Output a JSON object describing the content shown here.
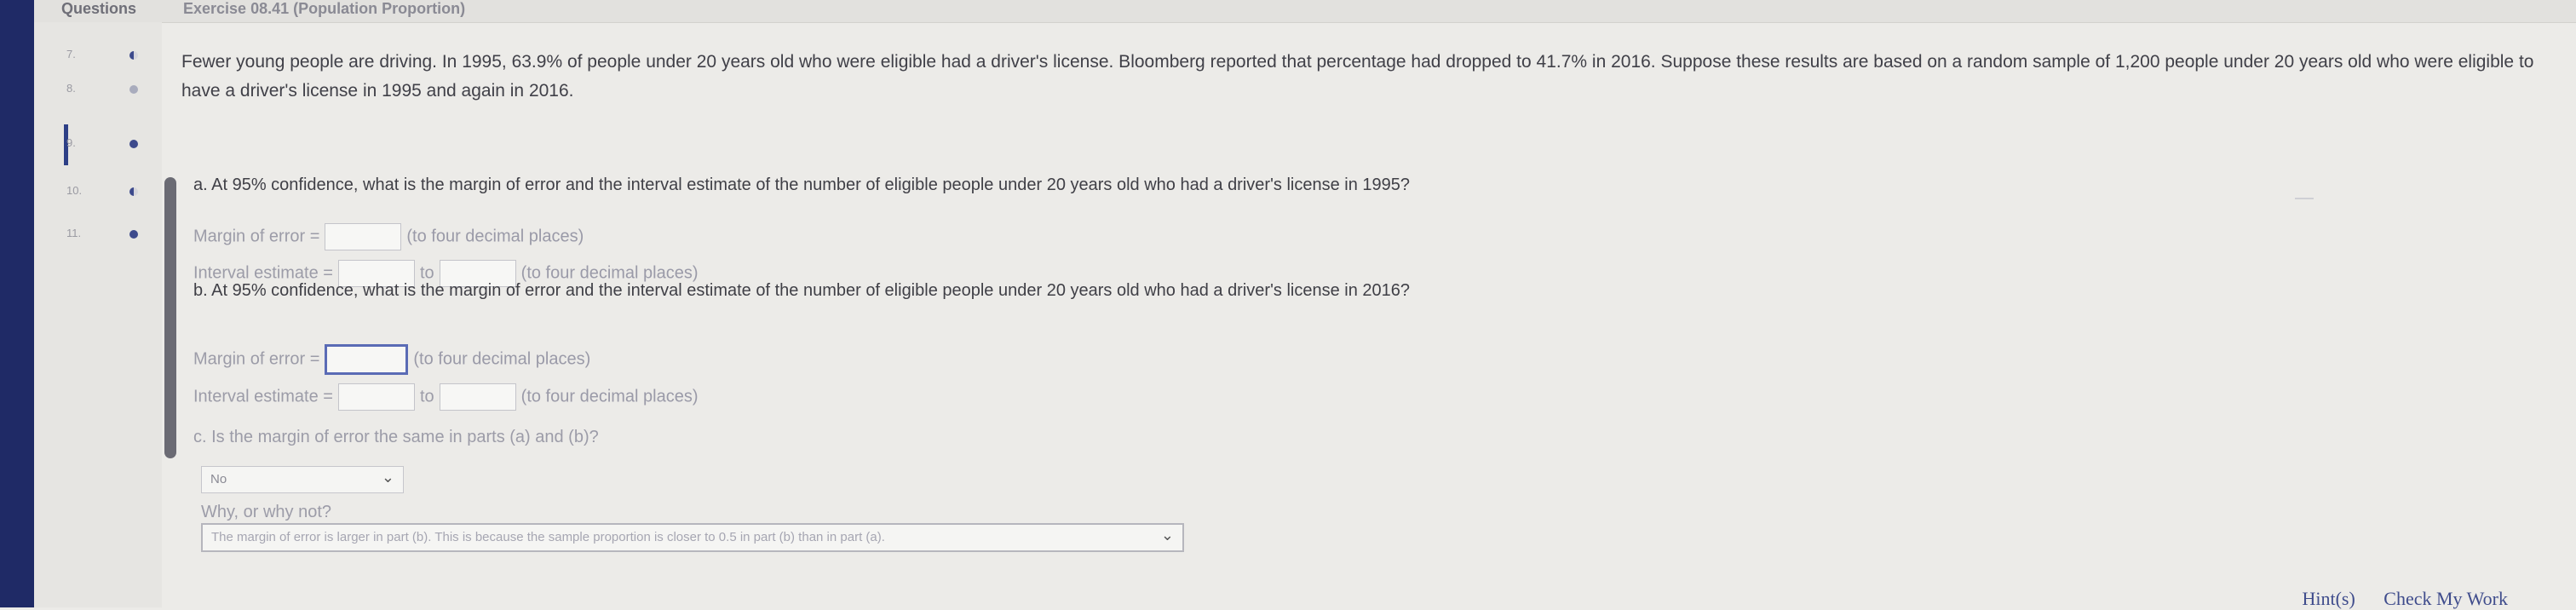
{
  "topbar": {
    "questions_tab": "Questions",
    "exercise_title": "Exercise 08.41 (Population Proportion)"
  },
  "sidebar": {
    "rows": [
      {
        "num": "7.",
        "status": "half"
      },
      {
        "num": "8.",
        "status": "dim"
      },
      {
        "num": "9.",
        "status": "filled",
        "active": true
      },
      {
        "num": "10.",
        "status": "half"
      },
      {
        "num": "11.",
        "status": "filled"
      }
    ]
  },
  "question": {
    "intro": "Fewer young people are driving. In 1995, 63.9% of people under 20 years old who were eligible had a driver's license. Bloomberg reported that percentage had dropped to 41.7% in 2016. Suppose these results are based on a random sample of 1,200 people under 20 years old who were eligible to have a driver's license in 1995 and again in 2016.",
    "part_a": "a. At 95% confidence, what is the margin of error and the interval estimate of the number of eligible people under 20 years old who had a driver's license in 1995?",
    "part_b": "b. At 95% confidence, what is the margin of error and the interval estimate of the number of eligible people under 20 years old who had a driver's license in 2016?",
    "part_c": "c. Is the margin of error the same in parts (a) and (b)?",
    "margin_label": "Margin of error =",
    "interval_label": "Interval estimate =",
    "to_word": "to",
    "four_places": "(to four decimal places)",
    "why_label": "Why, or why not?"
  },
  "answers": {
    "part_c_selected": "No",
    "why_selected": "The margin of error is larger in part (b). This is because the sample proportion is closer to 0.5 in part (b) than in part (a)."
  },
  "footer": {
    "hints": "Hint(s)",
    "check": "Check My Work"
  },
  "colors": {
    "accent": "#2d3f86",
    "background": "#ecebe8"
  }
}
